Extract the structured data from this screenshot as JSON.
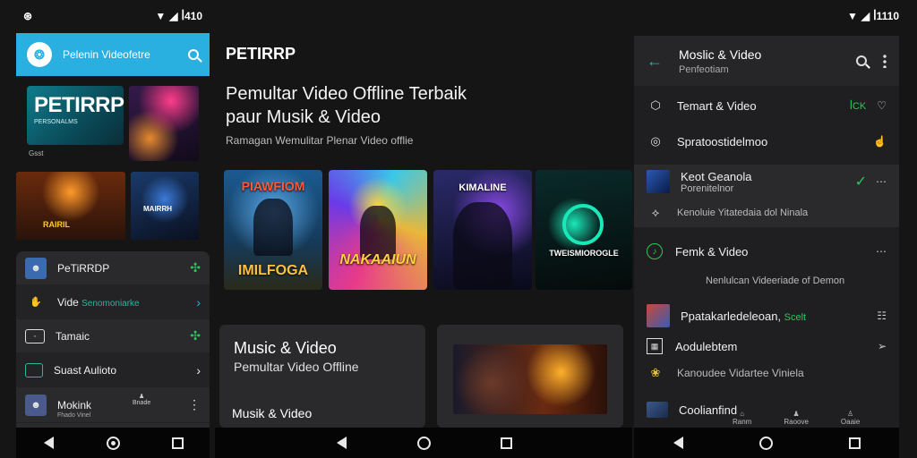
{
  "left_phone": {
    "status": {
      "left_icon": "⊛",
      "right_text": "ꟾ410"
    },
    "appbar": {
      "title": "Pelenin Videofetre"
    },
    "hero": {
      "big": "PETIRRP",
      "small": "PERSONALMS",
      "sub": "Gsst"
    },
    "poster2_text": "RAIRIL",
    "poster3_text": "MAIRRH",
    "list": [
      {
        "label": "PeTiRRDP",
        "accent": "",
        "right": "✣",
        "right_color": "#2ac85a"
      },
      {
        "label": "Vide ",
        "accent": "Senomoniarke",
        "right": "›",
        "right_color": "#2ab5e0"
      },
      {
        "label": "Tamaic",
        "accent": "",
        "right": "✣",
        "right_color": "#2ac85a"
      },
      {
        "label": "Suast Aulioto",
        "accent": "",
        "right": "›",
        "right_color": "#dddddd"
      },
      {
        "label": "Mokink",
        "accent": "",
        "right": "⋮",
        "right_color": "#dddddd",
        "sub": "Fhado Vinel",
        "mini": "Bnade"
      }
    ]
  },
  "mid": {
    "brand": "PETIRRP",
    "headline_1": "Pemultar Video Offline Terbaik",
    "headline_2": "paur Musik & Video",
    "tagline": "Ramagan Wemulitar Plenar Video offlie",
    "cards": [
      {
        "top": "PIAWFIOM",
        "bottom": "IMILFOGA"
      },
      {
        "bottom": "NAKAAIUN"
      },
      {
        "top": "KIMALINE"
      },
      {
        "mid": "TWEISMIOROGLE"
      }
    ],
    "info_card": {
      "title": "Music & Video",
      "subtitle": "Pemultar Video Offline",
      "footer": "Musik & Video"
    }
  },
  "right_phone": {
    "status": {
      "right_text": "ꟾ1110"
    },
    "header": {
      "title": "Moslic & Video",
      "subtitle": "Penfeotiam"
    },
    "rows": {
      "r1": {
        "label": "Temart & Video",
        "tag": "ꟾCK"
      },
      "r2": {
        "label": "Spratoostidelmoo"
      },
      "r3": {
        "label": "Keot Geanola",
        "sub1": "Porenitelnor",
        "sub2": "Kenoluie Yitatedaia dol Ninala"
      },
      "r4": {
        "label": "Femk & Video",
        "sub": "Nenlulcan Videeriade of Demon"
      },
      "r5": {
        "label": "Ppatakarledeleoan,",
        "tag": "Scelt"
      },
      "r6": {
        "label": "Aodulebtem"
      },
      "r7": {
        "label": "Kanoudee Vidartee Viniela"
      },
      "r8": {
        "label": "Coolianfind"
      }
    },
    "bottom_nav": [
      "Ranm",
      "Raoove",
      "Oaaie"
    ]
  },
  "icons": {
    "back": "back-arrow-icon",
    "search": "search-icon",
    "more": "more-vert-icon"
  },
  "colors": {
    "accent": "#2ab0e0",
    "teal": "#2ab5a0",
    "green": "#2ac85a",
    "bg": "#151515"
  }
}
